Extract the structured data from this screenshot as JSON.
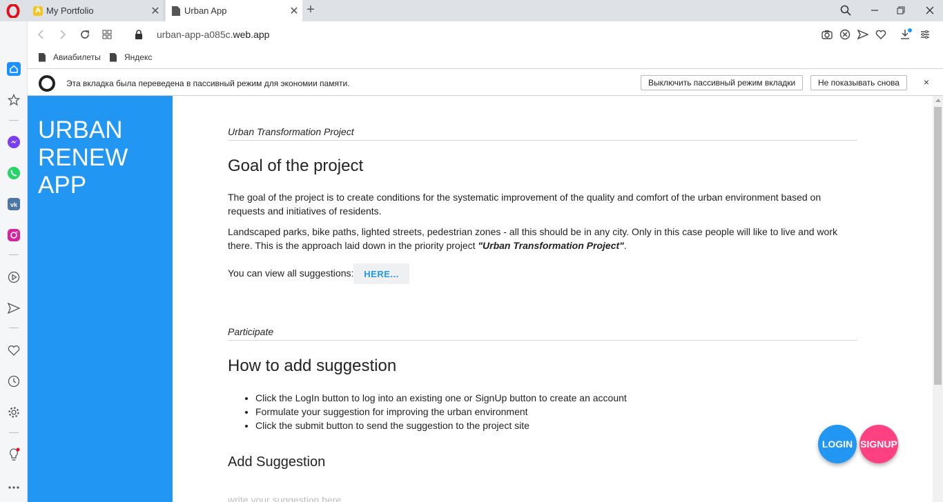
{
  "browser": {
    "tabs": [
      {
        "title": "My Portfolio",
        "active": false
      },
      {
        "title": "Urban App",
        "active": true
      }
    ],
    "url_prefix": "urban-app-a085c.",
    "url_domain": "web.app",
    "bookmarks": [
      "Авиабилеты",
      "Яндекс"
    ],
    "infobar": {
      "message": "Эта вкладка была переведена в пассивный режим для экономии памяти.",
      "disable_button": "Выключить пассивный режим вкладки",
      "dont_show_button": "Не показывать снова",
      "close": "×"
    },
    "sidebar_icons": [
      "home-icon",
      "star-icon",
      "messenger-icon",
      "whatsapp-icon",
      "vk-icon",
      "instagram-icon",
      "player-icon",
      "send-icon",
      "heart-icon",
      "history-icon",
      "settings-icon",
      "lightbulb-icon",
      "more-icon"
    ]
  },
  "app": {
    "title_lines": [
      "URBAN",
      "RENEW",
      "APP"
    ],
    "section1": {
      "label": "Urban Transformation Project",
      "heading": "Goal of the project",
      "p1": "The goal of the project is to create conditions for the systematic improvement of the quality and comfort of the urban environment based on requests and initiatives of residents.",
      "p2_start": "Landscaped parks, bike paths, lighted streets, pedestrian zones - all this should be in any city. Only in this case people will like to live and work there. This is the approach laid down in the priority project ",
      "p2_bold": "\"Urban Transformation Project\"",
      "p2_end": ".",
      "view_text": "You can view all suggestions:",
      "here_button": "HERE..."
    },
    "section2": {
      "label": "Participate",
      "heading": "How to add suggestion",
      "steps": [
        "Click the LogIn button to log into an existing one or SignUp button to create an account",
        "Formulate your suggestion for improving the urban environment",
        "Click the submit button to send the suggestion to the project site"
      ],
      "add_heading": "Add Suggestion",
      "input_placeholder": "write your suggestion here"
    },
    "login_button": "LOGIN",
    "signup_button": "SIGNUP"
  },
  "colors": {
    "primary": "#2196f3",
    "accent": "#ff4081",
    "opera_red": "#e0101a"
  }
}
